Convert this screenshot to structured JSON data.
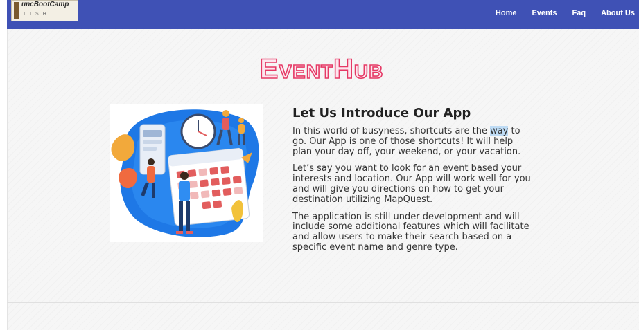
{
  "header": {
    "logo": {
      "title": "uncBootCamp",
      "subtitle": "T I S H I"
    },
    "nav": [
      {
        "label": "Home"
      },
      {
        "label": "Events"
      },
      {
        "label": "Faq"
      },
      {
        "label": "About Us"
      }
    ],
    "bar_color": "#3f51b5"
  },
  "brand": {
    "name": "EventHub",
    "color": "#e53965"
  },
  "intro": {
    "heading": "Let Us Introduce Our App",
    "p1_before": "In this world of busyness, shortcuts are the ",
    "p1_highlight": "way",
    "p1_after": " to go. Our App is one of those shortcuts! It will help plan your day off, your weekend, or your vacation.",
    "p2": "Let’s say you want to look for an event based your interests and location. Our App will work well for you and will give you directions on how to get your destination utilizing MapQuest.",
    "p3": "The application is still under development and will include some additional features which will facilitate and allow users to make their search based on a specific event name and genre type."
  },
  "illustration": {
    "name": "calendar-planning-illustration"
  }
}
